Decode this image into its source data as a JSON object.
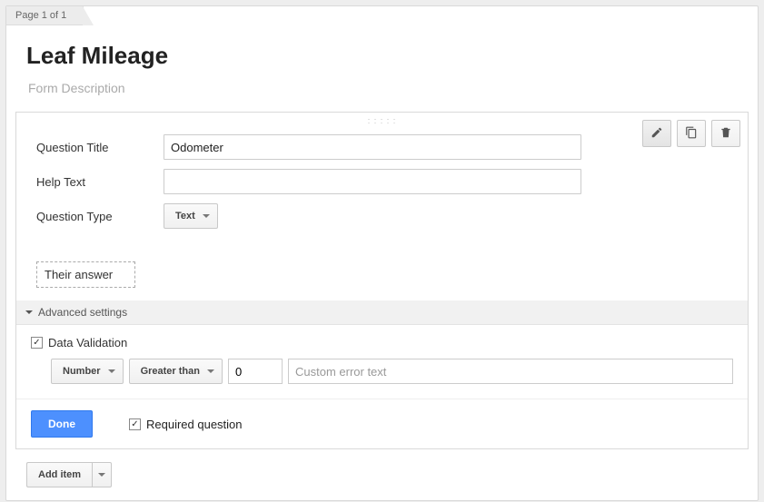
{
  "page_indicator": "Page 1 of 1",
  "header": {
    "title": "Leaf Mileage",
    "description_placeholder": "Form Description"
  },
  "question": {
    "labels": {
      "title": "Question Title",
      "help": "Help Text",
      "type": "Question Type"
    },
    "title_value": "Odometer",
    "help_value": "",
    "type_value": "Text",
    "answer_preview": "Their answer"
  },
  "advanced": {
    "heading": "Advanced settings",
    "data_validation_label": "Data Validation",
    "data_validation_checked": true,
    "validation": {
      "type": "Number",
      "operator": "Greater than",
      "value": "0",
      "error_placeholder": "Custom error text"
    }
  },
  "footer": {
    "done": "Done",
    "required_label": "Required question",
    "required_checked": true
  },
  "add_item_label": "Add item"
}
